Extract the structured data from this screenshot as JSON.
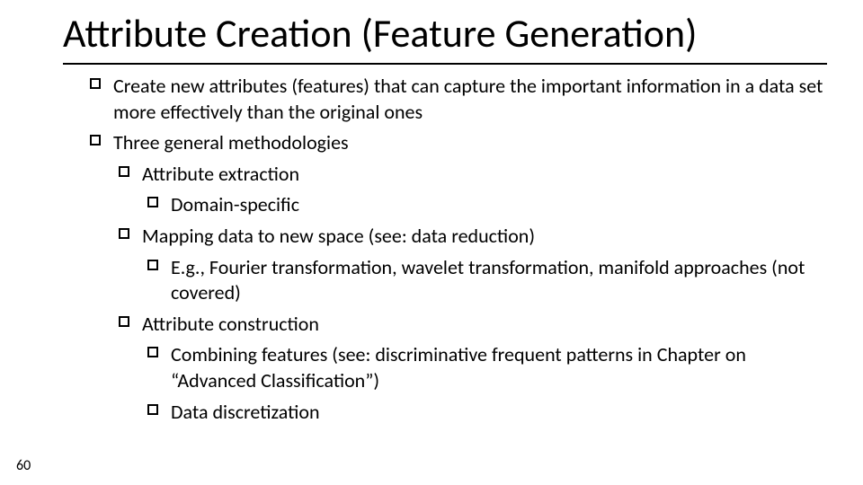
{
  "title": "Attribute Creation (Feature Generation)",
  "bullets": {
    "b1": "Create new attributes (features) that can capture the important information in a data set more effectively than the original ones",
    "b2": "Three general methodologies",
    "b2a": "Attribute extraction",
    "b2a1": "Domain-specific",
    "b2b": "Mapping data to new space (see: data reduction)",
    "b2b1": "E.g., Fourier transformation, wavelet transformation, manifold approaches (not covered)",
    "b2c": "Attribute construction",
    "b2c1": "Combining features (see: discriminative frequent patterns in Chapter on “Advanced Classification”)",
    "b2c2": "Data discretization"
  },
  "page_number": "60"
}
